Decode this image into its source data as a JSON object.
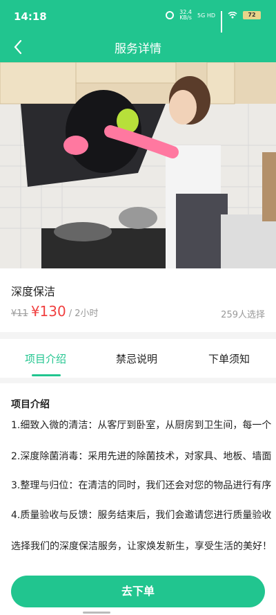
{
  "status": {
    "time": "14:18",
    "speed": "32.4\nKB/s",
    "network": "5G HD",
    "battery": "72"
  },
  "nav": {
    "title": "服务详情"
  },
  "service": {
    "name": "深度保洁",
    "old_price": "¥11",
    "price": "¥130",
    "unit": "/ 2小时",
    "selected": "259人选择"
  },
  "tabs": [
    "项目介绍",
    "禁忌说明",
    "下单须知"
  ],
  "intro": {
    "heading": "项目介绍",
    "items": [
      "1.细致入微的清洁：从客厅到卧室，从厨房到卫生间，每一个",
      "2.深度除菌消毒：采用先进的除菌技术，对家具、地板、墙面",
      "3.整理与归位：在清洁的同时，我们还会对您的物品进行有序",
      "4.质量验收与反馈：服务结束后，我们会邀请您进行质量验收",
      "选择我们的深度保洁服务，让家焕发新生，享受生活的美好！"
    ]
  },
  "cta": {
    "label": "去下单"
  },
  "colors": {
    "brand": "#21c58f",
    "price": "#f04040"
  }
}
